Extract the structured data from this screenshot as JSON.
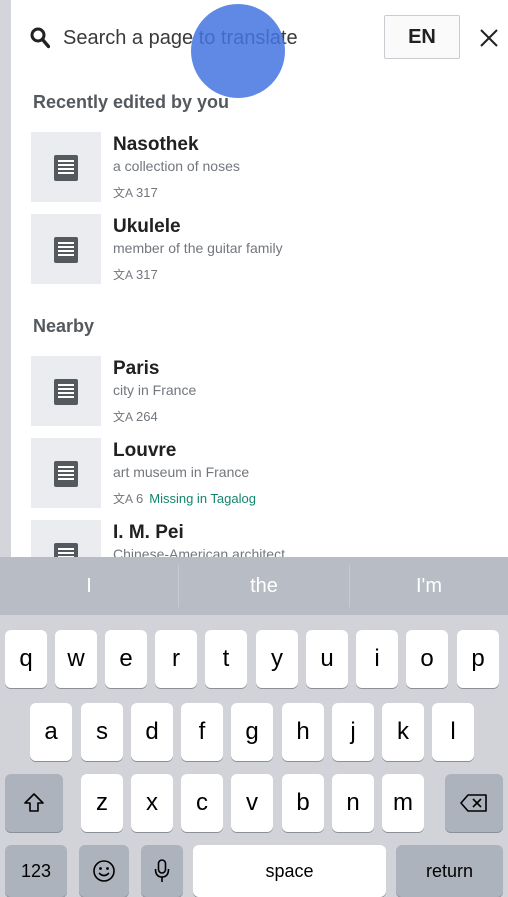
{
  "search": {
    "placeholder": "Search a page to translate"
  },
  "lang_button": "EN",
  "sections": {
    "recent": "Recently edited by you",
    "nearby": "Nearby"
  },
  "recent_items": [
    {
      "title": "Nasothek",
      "description": "a collection of noses",
      "count": "317"
    },
    {
      "title": "Ukulele",
      "description": "member of the guitar family",
      "count": "317"
    }
  ],
  "nearby_items": [
    {
      "title": "Paris",
      "description": "city in France",
      "count": "264"
    },
    {
      "title": "Louvre",
      "description": "art museum in France",
      "count": "6",
      "status": "Missing in Tagalog"
    },
    {
      "title": "I. M. Pei",
      "description": "Chinese-American architect"
    }
  ],
  "keyboard": {
    "suggestions": [
      "I",
      "the",
      "I'm"
    ],
    "row1": [
      "q",
      "w",
      "e",
      "r",
      "t",
      "y",
      "u",
      "i",
      "o",
      "p"
    ],
    "row2": [
      "a",
      "s",
      "d",
      "f",
      "g",
      "h",
      "j",
      "k",
      "l"
    ],
    "row3": [
      "z",
      "x",
      "c",
      "v",
      "b",
      "n",
      "m"
    ],
    "numbers": "123",
    "space": "space",
    "return": "return"
  },
  "colors": {
    "accent": "#14866d",
    "touch": "#4474e0"
  },
  "icons": {
    "search": "search-icon",
    "close": "close-icon",
    "article": "article-icon",
    "translate": "translate-icon",
    "shift": "shift-icon",
    "backspace": "backspace-icon",
    "emoji": "emoji-icon",
    "mic": "microphone-icon"
  }
}
